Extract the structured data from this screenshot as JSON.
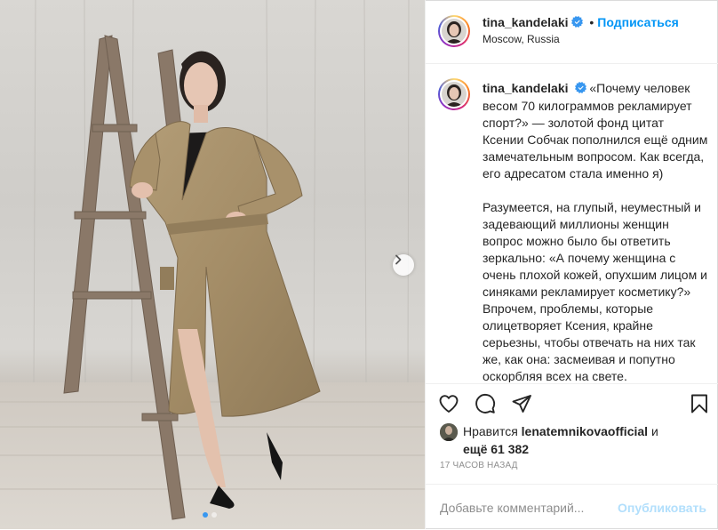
{
  "post": {
    "username": "tina_kandelaki",
    "follow_label": "Подписаться",
    "separator": "•",
    "location": "Moscow, Russia",
    "caption": "«Почему человек весом 70 килограммов рекламирует спорт?» — золотой фонд цитат Ксении Собчак пополнился ещё одним замечательным вопросом. Как всегда, его адресатом стала именно я)\n\nРазумеется, на глупый, неуместный и задевающий миллионы женщин вопрос можно было бы ответить зеркально: «А почему женщина с очень плохой кожей, опухшим лицом и синяками рекламирует косметику?» Впрочем, проблемы, которые олицетворяет Ксения, крайне серьезны, чтобы отвечать на них так же, как она: засмеивая и попутно оскорбляя всех на свете."
  },
  "likes": {
    "prefix": "Нравится",
    "user": "lenatemnikovaofficial",
    "connector": "и",
    "more": "ещё 61 382"
  },
  "timestamp": "17 ЧАСОВ НАЗАД",
  "comment": {
    "placeholder": "Добавьте комментарий...",
    "post_label": "Опубликовать"
  },
  "carousel": {
    "slides": 2,
    "current": 1
  },
  "icons": {
    "like": "heart-icon",
    "comment": "comment-icon",
    "share": "paper-plane-icon",
    "save": "bookmark-icon",
    "next": "chevron-right-icon",
    "verified": "verified-badge-icon"
  },
  "colors": {
    "accent": "#0095f6",
    "verified": "#3897f0",
    "muted": "#8e8e8e",
    "post_disabled": "#b2dffc"
  }
}
